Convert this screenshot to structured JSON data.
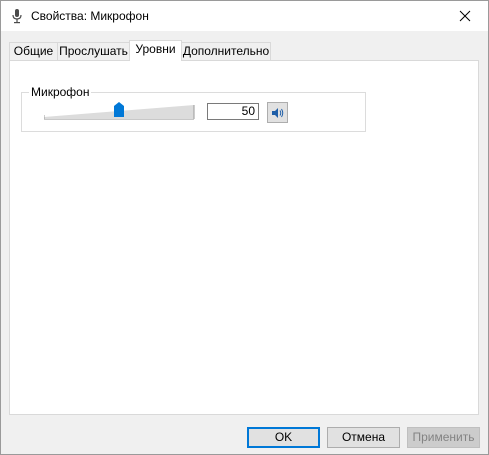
{
  "window": {
    "title": "Свойства: Микрофон",
    "icon": "microphone-icon",
    "close_icon": "close-icon"
  },
  "tabs": [
    {
      "label": "Общие",
      "active": false
    },
    {
      "label": "Прослушать",
      "active": false
    },
    {
      "label": "Уровни",
      "active": true
    },
    {
      "label": "Дополнительно",
      "active": false
    }
  ],
  "levels": {
    "group_label": "Микрофон",
    "value": "50",
    "slider_value": 50,
    "slider_max": 100,
    "mute_icon": "speaker-icon",
    "accent": "#0078d7"
  },
  "buttons": {
    "ok": "OK",
    "cancel": "Отмена",
    "apply": "Применить"
  }
}
